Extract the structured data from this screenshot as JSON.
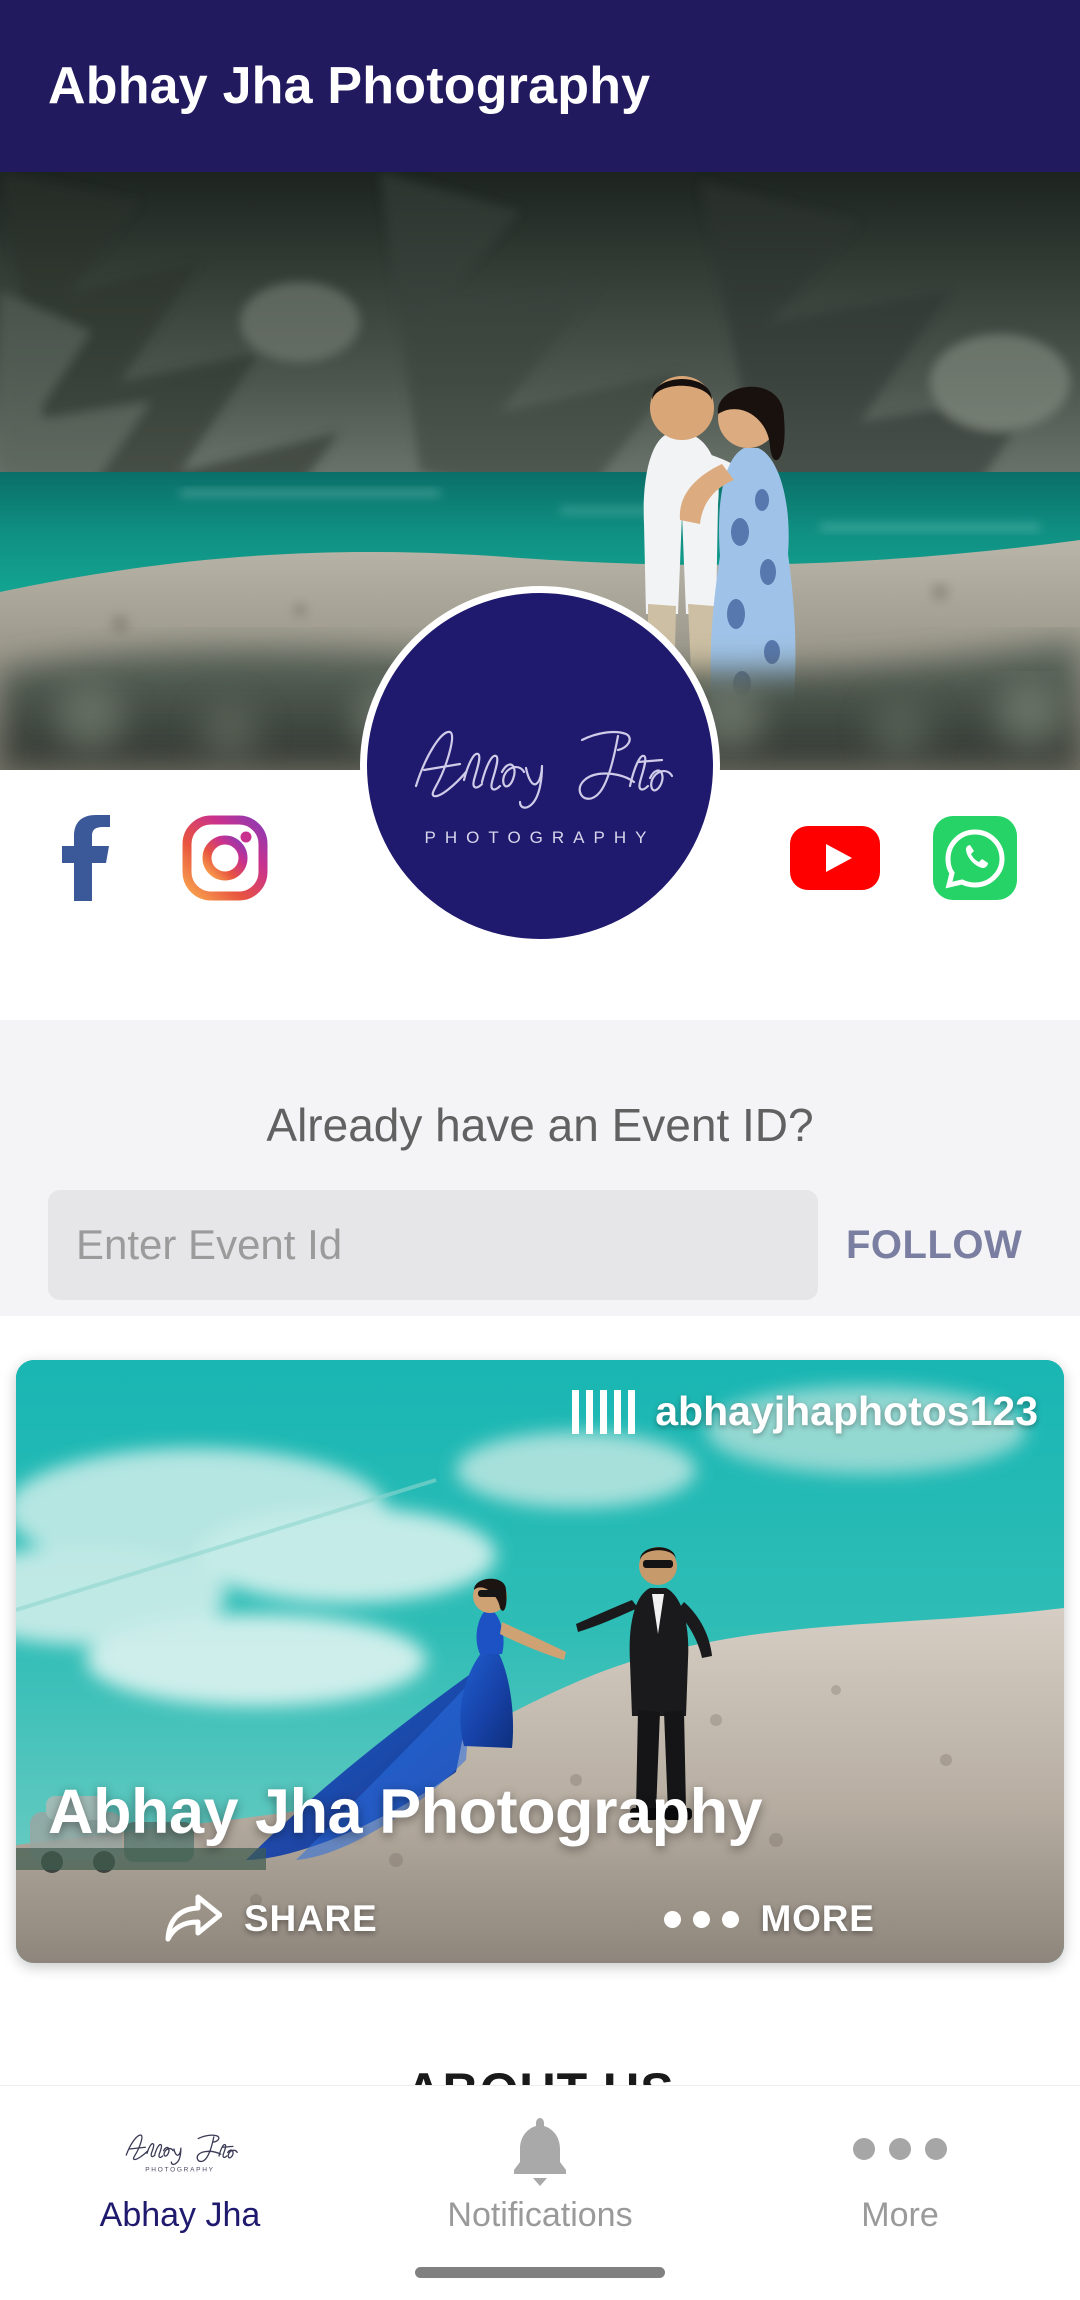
{
  "header": {
    "title": "Abhay Jha Photography"
  },
  "cover": {
    "alt": "Couple embracing on rocky lakeshore with turquoise water"
  },
  "profile": {
    "signature_name": "Abhay Jha",
    "subtitle": "PHOTOGRAPHY"
  },
  "social": {
    "items": [
      {
        "name": "facebook",
        "icon": "facebook-icon",
        "color": "#3B5998"
      },
      {
        "name": "instagram",
        "icon": "instagram-icon",
        "color": "#E1306C"
      },
      {
        "name": "youtube",
        "icon": "youtube-icon",
        "color": "#FF0000"
      },
      {
        "name": "whatsapp",
        "icon": "whatsapp-icon",
        "color": "#25D366"
      }
    ]
  },
  "event": {
    "title": "Already have an Event ID?",
    "input_placeholder": "Enter Event Id",
    "input_value": "",
    "follow_label": "FOLLOW",
    "follow_color": "#7A7EA1"
  },
  "card": {
    "handle": "abhayjhaphotos123",
    "title": "Abhay Jha Photography",
    "share_label": "SHARE",
    "more_label": "MORE",
    "alt": "Couple in blue gown and black suit walking on sand dune"
  },
  "about": {
    "heading": "ABOUT US"
  },
  "bottom_nav": {
    "items": [
      {
        "label": "Abhay Jha",
        "icon": "signature-logo-icon",
        "active": true
      },
      {
        "label": "Notifications",
        "icon": "bell-icon",
        "active": false
      },
      {
        "label": "More",
        "icon": "more-dots-icon",
        "active": false
      }
    ]
  },
  "theme": {
    "header_bg": "#211A5E",
    "logo_bg": "#1F1A6E",
    "section_bg": "#F4F4F6",
    "input_bg": "#E6E6E8"
  }
}
